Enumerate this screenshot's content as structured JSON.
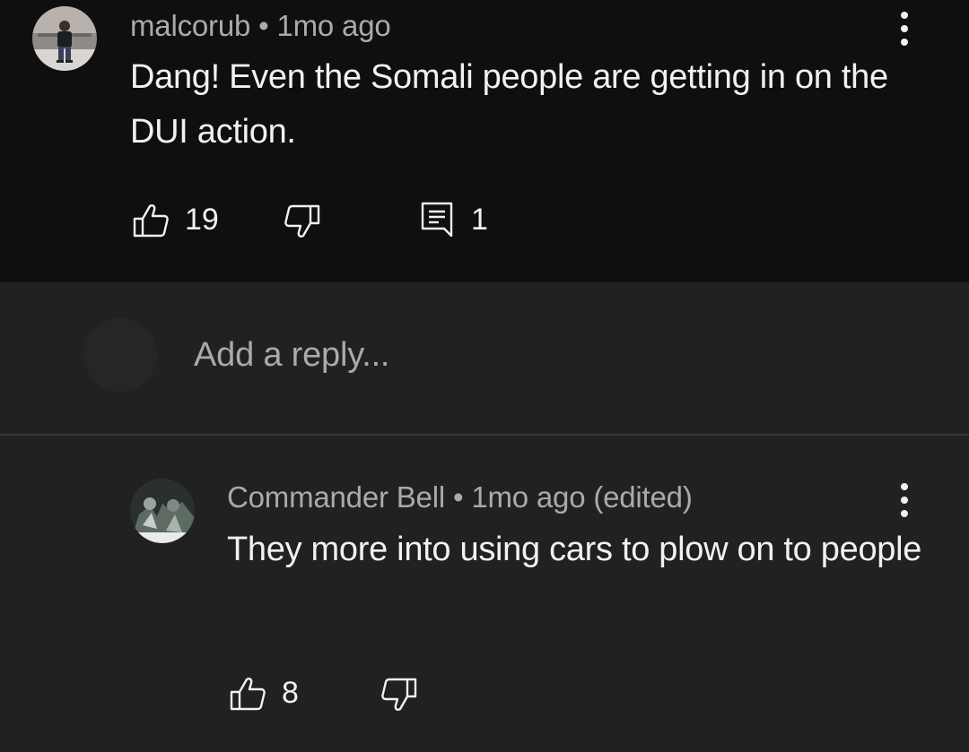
{
  "comment": {
    "author": "malcorub",
    "separator": "•",
    "time": "1mo ago",
    "text": "Dang!  Even the Somali people are getting in on the DUI action.",
    "likes": "19",
    "replies": "1",
    "icons": {
      "avatar": "user-avatar-photo",
      "like": "thumbs-up-icon",
      "dislike": "thumbs-down-icon",
      "reply": "reply-comment-icon",
      "menu": "more-vert-icon"
    }
  },
  "reply_input": {
    "placeholder": "Add a reply..."
  },
  "reply": {
    "author": "Commander Bell",
    "separator": "•",
    "time": "1mo ago (edited)",
    "text": "They more into using cars to plow on to people",
    "likes": "8",
    "icons": {
      "avatar": "user-avatar-image",
      "like": "thumbs-up-icon",
      "dislike": "thumbs-down-icon",
      "menu": "more-vert-icon"
    }
  },
  "colors": {
    "top_background": "#0f0f0f",
    "background": "#212121",
    "primary_text": "#f1f1f1",
    "secondary_text": "#aaaaaa"
  }
}
